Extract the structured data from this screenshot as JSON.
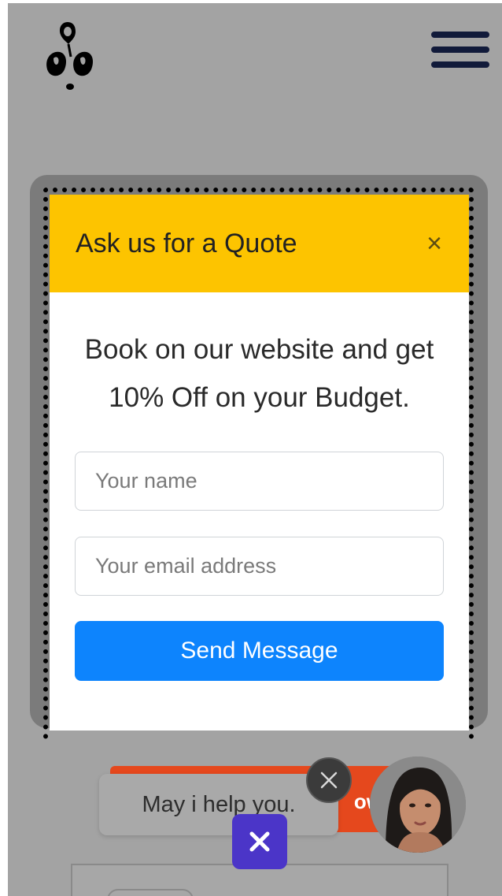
{
  "header": {
    "logo_icon": "ink-drop-figures-logo",
    "menu_icon": "hamburger-menu-icon"
  },
  "background": {
    "cta_text": "ow"
  },
  "modal": {
    "title": "Ask us for a Quote",
    "close_glyph": "×",
    "promo_text": "Book on our website and get 10% Off on your Budget.",
    "name_placeholder": "Your name",
    "email_placeholder": "Your email address",
    "send_label": "Send Message"
  },
  "chat": {
    "bubble_text": "May i help you.",
    "avatar_icon": "support-agent-avatar"
  },
  "colors": {
    "header_yellow": "#fdc400",
    "primary_blue": "#0d84fd",
    "chat_purple": "#4b35c8",
    "cta_orange": "#e5481d"
  }
}
